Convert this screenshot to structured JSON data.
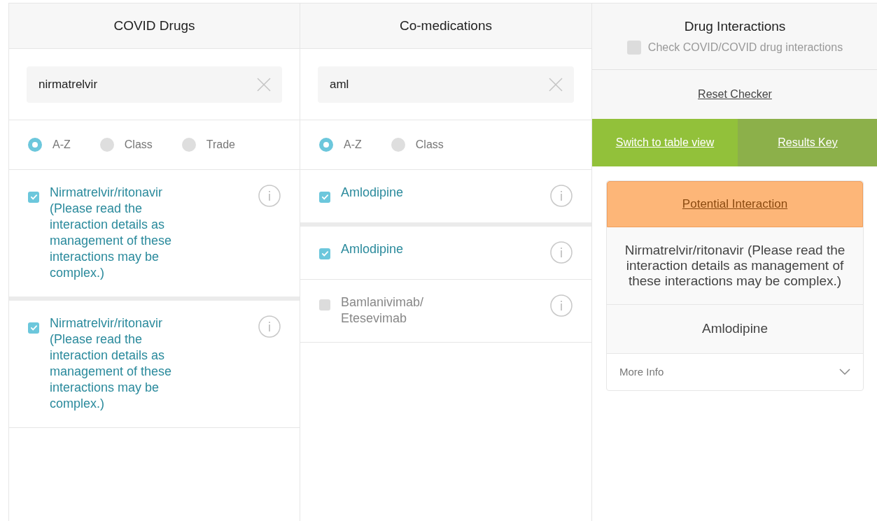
{
  "covid_drugs": {
    "title": "COVID Drugs",
    "search": {
      "value": "nirmatrelvir"
    },
    "sort_options": [
      {
        "label": "A-Z",
        "selected": true
      },
      {
        "label": "Class",
        "selected": false
      },
      {
        "label": "Trade",
        "selected": false
      }
    ],
    "items": [
      {
        "name": "Nirmatrelvir/ritonavir (Please read the interaction details as management of these interactions may be complex.)",
        "checked": true
      },
      {
        "name": "Nirmatrelvir/ritonavir (Please read the interaction details as management of these interactions may be complex.)",
        "checked": true
      }
    ]
  },
  "co_medications": {
    "title": "Co-medications",
    "search": {
      "value": "aml"
    },
    "sort_options": [
      {
        "label": "A-Z",
        "selected": true
      },
      {
        "label": "Class",
        "selected": false
      }
    ],
    "items": [
      {
        "name": "Amlodipine",
        "checked": true
      },
      {
        "name": "Amlodipine",
        "checked": true
      },
      {
        "name": "Bamlanivimab/ Etesevimab",
        "checked": false
      }
    ]
  },
  "drug_interactions": {
    "title": "Drug Interactions",
    "covid_covid_check": {
      "label": "Check COVID/COVID drug interactions",
      "checked": false
    },
    "reset_link": "Reset Checker",
    "table_view_link": "Switch to table view",
    "results_key_link": "Results Key",
    "result": {
      "status": "Potential Interaction",
      "drug_a": "Nirmatrelvir/ritonavir (Please read the interaction details as management of these interactions may be complex.)",
      "drug_b": "Amlodipine",
      "more_info": "More Info",
      "expanded": false
    }
  }
}
